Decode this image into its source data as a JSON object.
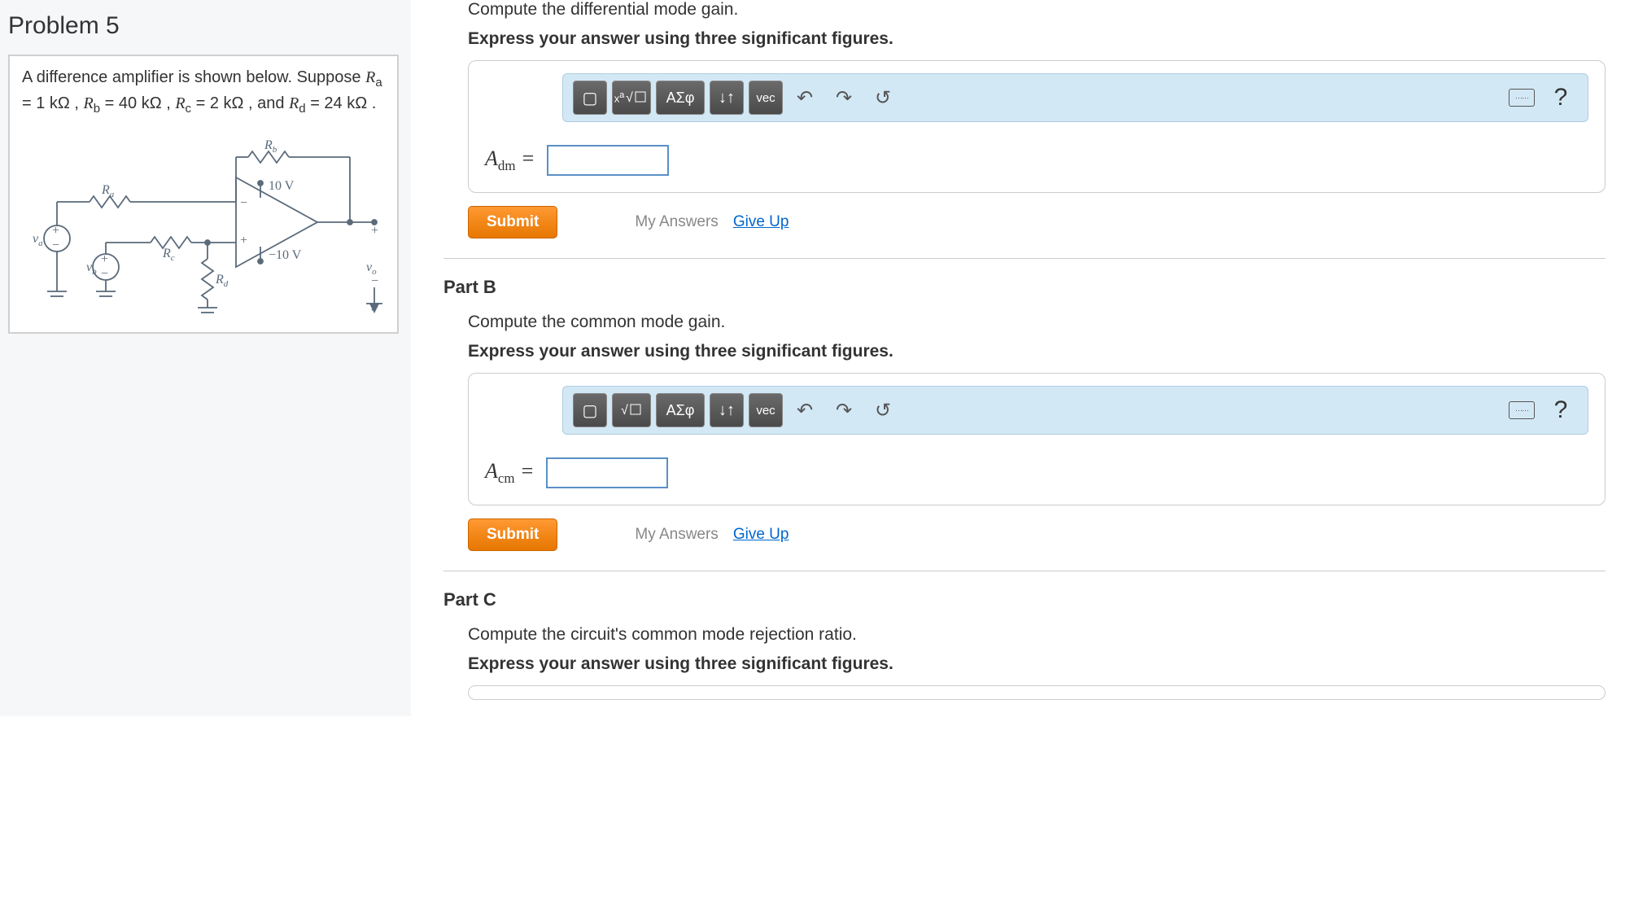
{
  "problem": {
    "title": "Problem 5",
    "desc_pre": "A difference amplifier is shown below. Suppose ",
    "ra_var": "R",
    "ra_sub": "a",
    "eq1": " = 1  kΩ , ",
    "rb_var": "R",
    "rb_sub": "b",
    "eq2": " = 40  kΩ , ",
    "rc_var": "R",
    "rc_sub": "c",
    "eq3": " = 2  kΩ , and ",
    "rd_var": "R",
    "rd_sub": "d",
    "eq4": " = 24  kΩ ."
  },
  "circuit": {
    "labels": {
      "Rb": "R",
      "Rb_sub": "b",
      "Ra": "R",
      "Ra_sub": "a",
      "Rc": "R",
      "Rc_sub": "c",
      "Rd": "R",
      "Rd_sub": "d",
      "va": "v",
      "va_sub": "a",
      "vb": "v",
      "vb_sub": "b",
      "vo": "v",
      "vo_sub": "o",
      "v10": "10 V",
      "vn10": "−10 V"
    }
  },
  "partA": {
    "instruction1": "Compute the differential mode gain.",
    "instruction2": "Express your answer using three significant figures.",
    "answer_symbol": "A",
    "answer_sub": "dm",
    "equals": " ="
  },
  "partB": {
    "heading": "Part B",
    "instruction1": "Compute the common mode gain.",
    "instruction2": "Express your answer using three significant figures.",
    "answer_symbol": "A",
    "answer_sub": "cm",
    "equals": " ="
  },
  "partC": {
    "heading": "Part C",
    "instruction1": "Compute the circuit's common mode rejection ratio.",
    "instruction2": "Express your answer using three significant figures."
  },
  "toolbar": {
    "template": "▢",
    "sqrt": "√□",
    "greek": "ΑΣφ",
    "arrows": "↓↑",
    "vec": "vec",
    "undo": "↶",
    "redo": "↷",
    "reset": "↺",
    "help": "?"
  },
  "actions": {
    "submit": "Submit",
    "my_answers": "My Answers",
    "give_up": "Give Up"
  }
}
